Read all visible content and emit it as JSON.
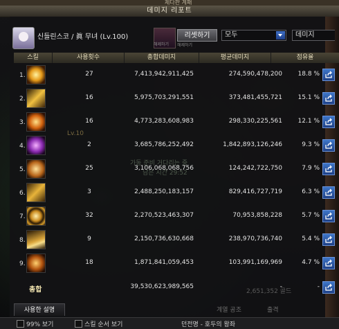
{
  "window": {
    "title": "데미지 리포트"
  },
  "header": {
    "character_name": "신들린스코 / 眞 무녀 (Lv.100)",
    "icon_label_left": "해제하기",
    "icon_label_right": "해제하기",
    "reset_button": "리셋하기",
    "filter_dropdown": "모두",
    "type_dropdown": "데미지"
  },
  "table": {
    "columns": [
      "스킬",
      "사용횟수",
      "총합데미지",
      "평균데미지",
      "점유율"
    ],
    "rows": [
      {
        "rank": "1.",
        "icon": "skill-fire-wheel-icon",
        "count": "27",
        "total": "7,413,942,911,425",
        "avg": "274,590,478,200",
        "share": "18.8 %"
      },
      {
        "rank": "2.",
        "icon": "skill-golden-blade-icon",
        "count": "16",
        "total": "5,975,703,291,551",
        "avg": "373,481,455,721",
        "share": "15.1 %"
      },
      {
        "rank": "3.",
        "icon": "skill-flame-spiral-icon",
        "count": "16",
        "total": "4,773,283,608,983",
        "avg": "298,330,225,561",
        "share": "12.1 %"
      },
      {
        "rank": "4.",
        "icon": "skill-violet-strike-icon",
        "count": "2",
        "total": "3,685,786,252,492",
        "avg": "1,842,893,126,246",
        "share": "9.3 %"
      },
      {
        "rank": "5.",
        "icon": "skill-amber-orb-icon",
        "count": "25",
        "total": "3,106,068,068,756",
        "avg": "124,242,722,750",
        "share": "7.9 %"
      },
      {
        "rank": "6.",
        "icon": "skill-golden-beast-icon",
        "count": "3",
        "total": "2,488,250,183,157",
        "avg": "829,416,727,719",
        "share": "6.3 %"
      },
      {
        "rank": "7.",
        "icon": "skill-vortex-icon",
        "count": "32",
        "total": "2,270,523,463,307",
        "avg": "70,953,858,228",
        "share": "5.7 %"
      },
      {
        "rank": "8.",
        "icon": "skill-sun-sword-icon",
        "count": "9",
        "total": "2,150,736,630,668",
        "avg": "238,970,736,740",
        "share": "5.4 %"
      },
      {
        "rank": "9.",
        "icon": "skill-blaze-icon",
        "count": "18",
        "total": "1,871,841,059,453",
        "avg": "103,991,169,969",
        "share": "4.7 %"
      }
    ],
    "total": {
      "label": "총합",
      "total": "39,530,623,989,565",
      "avg": "-",
      "share": "-"
    }
  },
  "tabs": {
    "description": "사용한 설명"
  },
  "background": {
    "top_text": "제다판 계패",
    "mid_text_1": "가동 준비 거다리는 중",
    "mid_text_2": "남은 시간 29:52",
    "level_text": "Lv.10",
    "bottom_left": "99% 보기",
    "bottom_mid": "스킬 순서 보기",
    "bottom_right": "던전명 - 호두의 왕좌",
    "ghost_button_1": "계열 공조",
    "ghost_button_2": "출격",
    "ghost_number": "2,651,352 골드"
  },
  "colors": {
    "header_gold": "#e2d9b9",
    "share_button": "#2d5fb0",
    "dropdown_arrow": "#2f5bb0"
  }
}
